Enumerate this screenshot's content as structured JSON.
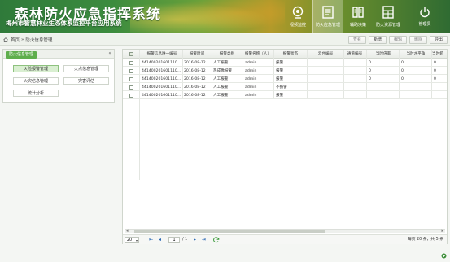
{
  "header": {
    "title": "森林防火应急指挥系统",
    "subtitle": "梅州市智慧林业生态体系监控平台应用系统",
    "nav": [
      {
        "label": "视频监控",
        "icon": "camera-icon",
        "active": false
      },
      {
        "label": "防火应急管理",
        "icon": "document-icon",
        "active": true
      },
      {
        "label": "辅助决策",
        "icon": "book-icon",
        "active": false
      },
      {
        "label": "防火资源管理",
        "icon": "grid-icon",
        "active": false
      }
    ],
    "user": {
      "label": "管理员",
      "icon": "power-icon"
    }
  },
  "breadcrumb": {
    "home": "首页",
    "separator": "»",
    "current": "防火信息管理"
  },
  "toolbar": {
    "view": "查看",
    "add": "新增",
    "edit": "编辑",
    "delete": "删除",
    "export": "导出"
  },
  "left_panel": {
    "tab": "防火信息管理",
    "collapse": "«",
    "buttons": [
      "火险报警管理",
      "火点信息管理",
      "火灾信息管理",
      "灾害评估",
      "统计分析"
    ]
  },
  "grid": {
    "columns": [
      "报警信息唯一编号",
      "报警时间",
      "报警类别",
      "报警名称（人）",
      "报警状态",
      "云台编号",
      "通道编号",
      "当时倍率",
      "当时水平角",
      "当时俯"
    ],
    "rows": [
      [
        "441400201601110...",
        "2016-08-12",
        "人工报警",
        "admin",
        "报警",
        "",
        "",
        "0",
        "0",
        "0"
      ],
      [
        "441400201601110...",
        "2016-08-12",
        "热成像报警",
        "admin",
        "报警",
        "",
        "",
        "0",
        "0",
        "0"
      ],
      [
        "441400201601110...",
        "2016-08-12",
        "人工报警",
        "admin",
        "报警",
        "",
        "",
        "0",
        "0",
        "0"
      ],
      [
        "441400201601110...",
        "2016-08-12",
        "人工报警",
        "admin",
        "不报警",
        "",
        "",
        "",
        "",
        ""
      ],
      [
        "441400201601110...",
        "2016-08-12",
        "人工报警",
        "admin",
        "报警",
        "",
        "",
        "",
        "",
        ""
      ]
    ]
  },
  "pager": {
    "page_size": "20",
    "page": "1",
    "total_pages_text": "/ 1",
    "info": "每页 20 条，共 5 条"
  },
  "colors": {
    "brand_green": "#5fae4d",
    "header_green": "#3c8c3e"
  }
}
